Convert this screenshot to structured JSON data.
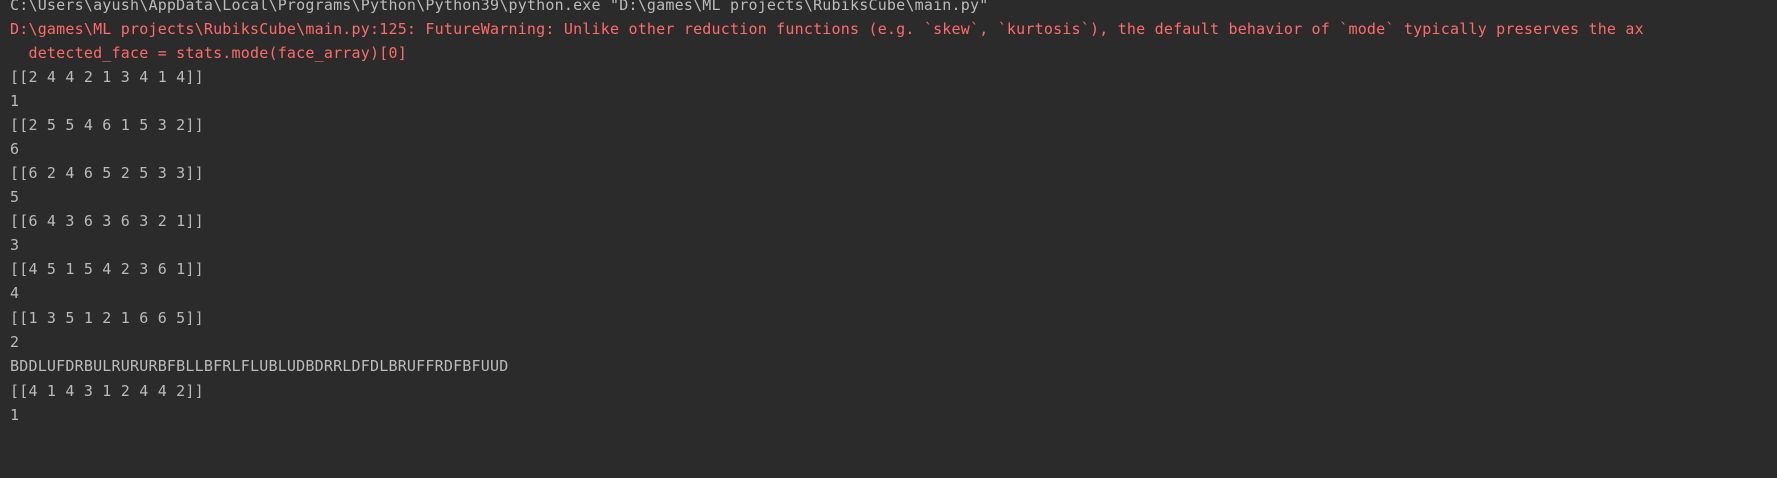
{
  "console": {
    "lines": [
      {
        "text": "C:\\Users\\ayush\\AppData\\Local\\Programs\\Python\\Python39\\python.exe \"D:\\games\\ML projects\\RubiksCube\\main.py\"",
        "kind": "normal"
      },
      {
        "text": "D:\\games\\ML projects\\RubiksCube\\main.py:125: FutureWarning: Unlike other reduction functions (e.g. `skew`, `kurtosis`), the default behavior of `mode` typically preserves the ax",
        "kind": "error"
      },
      {
        "text": "  detected_face = stats.mode(face_array)[0]",
        "kind": "error"
      },
      {
        "text": "[[2 4 4 2 1 3 4 1 4]]",
        "kind": "normal"
      },
      {
        "text": "1",
        "kind": "normal"
      },
      {
        "text": "[[2 5 5 4 6 1 5 3 2]]",
        "kind": "normal"
      },
      {
        "text": "6",
        "kind": "normal"
      },
      {
        "text": "[[6 2 4 6 5 2 5 3 3]]",
        "kind": "normal"
      },
      {
        "text": "5",
        "kind": "normal"
      },
      {
        "text": "[[6 4 3 6 3 6 3 2 1]]",
        "kind": "normal"
      },
      {
        "text": "3",
        "kind": "normal"
      },
      {
        "text": "[[4 5 1 5 4 2 3 6 1]]",
        "kind": "normal"
      },
      {
        "text": "4",
        "kind": "normal"
      },
      {
        "text": "[[1 3 5 1 2 1 6 6 5]]",
        "kind": "normal"
      },
      {
        "text": "2",
        "kind": "normal"
      },
      {
        "text": "BDDLUFDRBULRURURBFBLLBFRLFLUBLUDBDRRLDFDLBRUFFRDFBFUUD",
        "kind": "normal"
      },
      {
        "text": "[[4 1 4 3 1 2 4 4 2]]",
        "kind": "normal"
      },
      {
        "text": "1",
        "kind": "normal"
      }
    ],
    "colors": {
      "background": "#2b2b2b",
      "normal_text": "#bbbbbb",
      "error_text": "#ff6b68"
    }
  }
}
